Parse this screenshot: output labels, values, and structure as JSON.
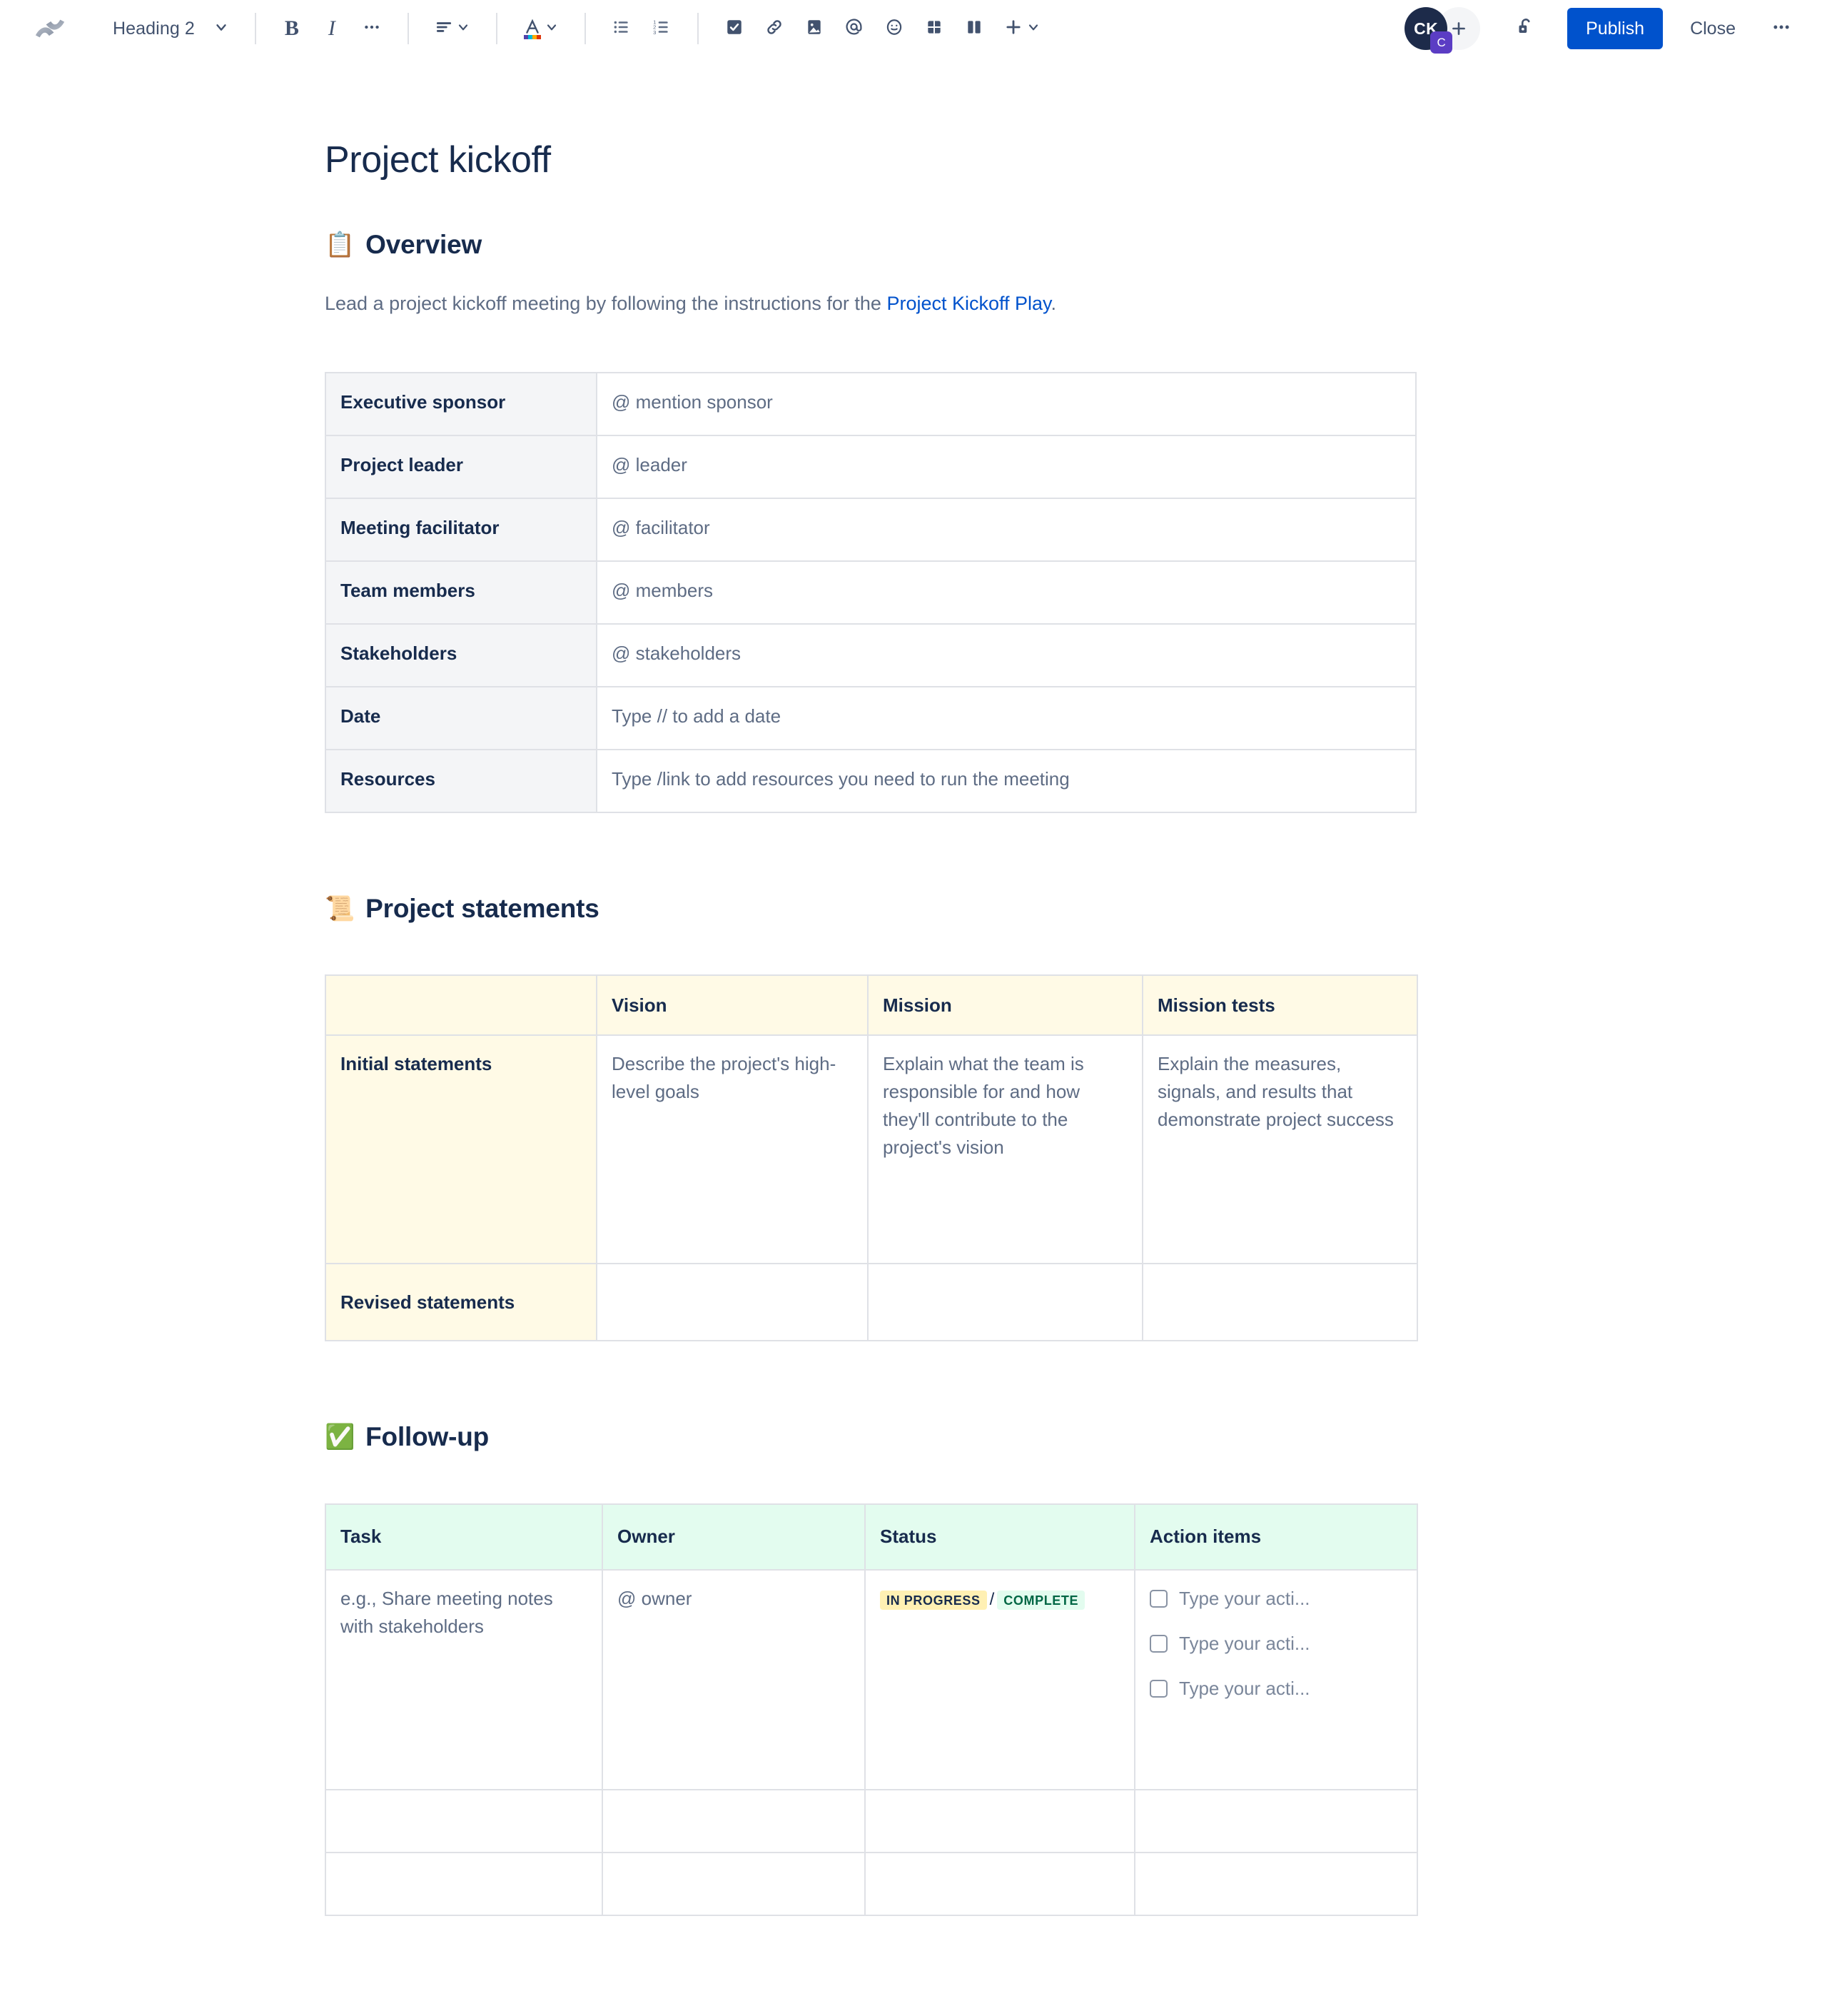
{
  "toolbar": {
    "logo_icon": "confluence-logo",
    "style_selector": {
      "label": "Heading 2",
      "chevron": "chevron-down-icon"
    },
    "buttons": [
      {
        "name": "bold-button",
        "icon": "bold-icon",
        "label": "B"
      },
      {
        "name": "italic-button",
        "icon": "italic-icon",
        "label": "I"
      },
      {
        "name": "more-formatting-button",
        "icon": "ellipsis-icon",
        "label": "•••"
      },
      {
        "name": "text-alignment-button",
        "icon": "align-left-icon"
      },
      {
        "name": "text-color-button",
        "icon": "text-color-icon",
        "label": "A"
      },
      {
        "name": "bullet-list-button",
        "icon": "bullet-list-icon"
      },
      {
        "name": "numbered-list-button",
        "icon": "numbered-list-icon"
      },
      {
        "name": "action-item-button",
        "icon": "checkbox-filled-icon"
      },
      {
        "name": "link-button",
        "icon": "link-icon"
      },
      {
        "name": "image-button",
        "icon": "image-icon"
      },
      {
        "name": "mention-button",
        "icon": "at-mention-icon"
      },
      {
        "name": "emoji-button",
        "icon": "emoji-smiley-icon"
      },
      {
        "name": "table-button",
        "icon": "table-icon"
      },
      {
        "name": "layout-button",
        "icon": "two-column-layout-icon"
      },
      {
        "name": "insert-more-button",
        "icon": "plus-icon"
      }
    ],
    "avatar": {
      "initials": "CK",
      "badge": "C",
      "add_label": "+",
      "add_name": "add-collaborator-button"
    },
    "restrictions_icon": "unlocked-padlock-icon",
    "publish_label": "Publish",
    "close_label": "Close",
    "overflow_label": "•••"
  },
  "accent_colors": {
    "publish_blue": "#0052cc",
    "link_blue": "#0052cc",
    "header_navy": "#172b4d",
    "body_grey": "#5e6c84",
    "overview_header_bg": "#f4f5f7",
    "statements_header_bg": "#fffae6",
    "followup_header_bg": "#e3fcef",
    "border_grey": "#dfe1e6",
    "lozenge_yellow_bg": "#fff0b3",
    "lozenge_green_bg": "#e3fcef",
    "lozenge_green_text": "#006644"
  },
  "document": {
    "title": "Project kickoff",
    "sections": {
      "overview": {
        "emoji": "📋",
        "emoji_name": "clipboard-emoji",
        "heading": "Overview",
        "lead_before": "Lead a project kickoff meeting by following the instructions for the ",
        "lead_link": "Project Kickoff Play",
        "lead_after": ".",
        "rows": [
          {
            "key": "Executive sponsor",
            "value": "@ mention sponsor"
          },
          {
            "key": "Project leader",
            "value": "@ leader"
          },
          {
            "key": "Meeting facilitator",
            "value": "@ facilitator"
          },
          {
            "key": "Team members",
            "value": "@ members"
          },
          {
            "key": "Stakeholders",
            "value": "@ stakeholders"
          },
          {
            "key": "Date",
            "value": "Type // to add a date"
          },
          {
            "key": "Resources",
            "value": "Type /link to add resources you need to run the meeting"
          }
        ]
      },
      "statements": {
        "emoji": "📜",
        "emoji_name": "scroll-emoji",
        "heading": "Project statements",
        "headers": [
          "",
          "Vision",
          "Mission",
          "Mission tests"
        ],
        "rows": [
          {
            "label": "Initial statements",
            "vision": "Describe the project's high-level goals",
            "mission": "Explain what the team is responsible for and how they'll contribute to the project's vision",
            "mission_tests": "Explain the measures, signals, and results that demonstrate project success"
          },
          {
            "label": "Revised statements",
            "vision": "",
            "mission": "",
            "mission_tests": ""
          }
        ]
      },
      "followup": {
        "emoji": "✅",
        "emoji_name": "white-check-mark-emoji",
        "heading": "Follow-up",
        "headers": [
          "Task",
          "Owner",
          "Status",
          "Action items"
        ],
        "rows": [
          {
            "task": "e.g., Share meeting notes with stakeholders",
            "owner": "@ owner",
            "status_in_progress": "IN PROGRESS",
            "status_separator": "/",
            "status_complete": "COMPLETE",
            "action_items": [
              "Type your acti...",
              "Type your acti...",
              "Type your acti..."
            ]
          },
          {
            "task": "",
            "owner": "",
            "action_items": []
          },
          {
            "task": "",
            "owner": "",
            "action_items": []
          }
        ]
      }
    }
  }
}
